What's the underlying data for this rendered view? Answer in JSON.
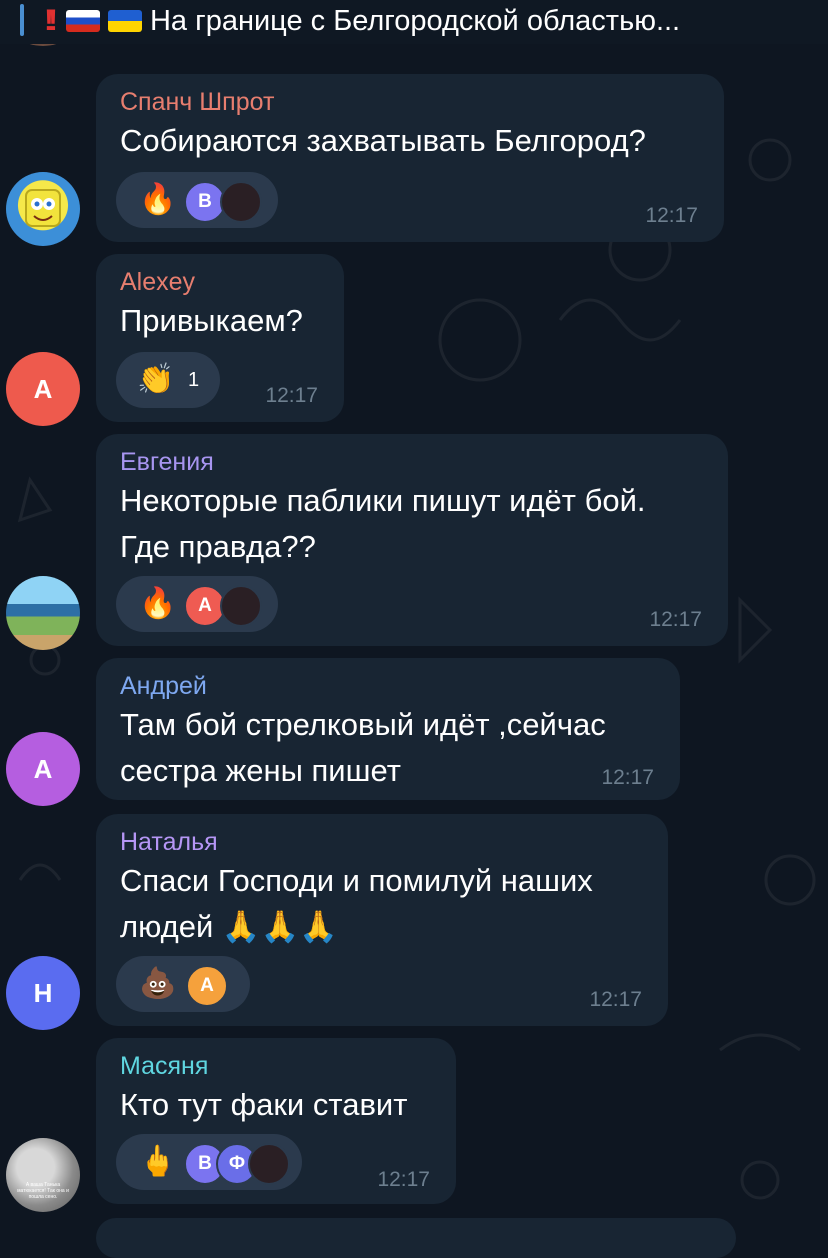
{
  "pinned": {
    "excl": "!!",
    "title": "На границе с Белгородской областью..."
  },
  "colors": {
    "background": "#0e1621",
    "bubble": "#182533",
    "reaction_bg": "#2b3a4d",
    "time": "#6d7f8f",
    "name_spanch": "#e77e6f",
    "name_alexey": "#e77e6f",
    "name_evgenia": "#a795f0",
    "name_andrey": "#7ea8f0",
    "name_natalya": "#b596f5",
    "name_masyanya": "#5fd6e0"
  },
  "messages": [
    {
      "author": "Спанч Шпрот",
      "lines": [
        "Собираются захватывать Белгород?"
      ],
      "time": "12:17",
      "avatar": {
        "type": "image",
        "icon": "spongebob-avatar-icon"
      },
      "reactions": [
        {
          "emoji": "🔥",
          "icon": "fire-icon",
          "avatars": [
            {
              "letter": "B",
              "color": "#7b74f0"
            },
            {
              "letter": "",
              "color": "#2a1f24"
            }
          ]
        }
      ]
    },
    {
      "author": "Alexey",
      "lines": [
        "Привыкаем?"
      ],
      "time": "12:17",
      "avatar": {
        "type": "letter",
        "letter": "A",
        "color": "#ee5a4d"
      },
      "reactions": [
        {
          "emoji": "👏",
          "icon": "clapping-hands-icon",
          "count": "1"
        }
      ]
    },
    {
      "author": "Евгения",
      "lines": [
        "Некоторые паблики пишут идёт бой.",
        "Где правда??"
      ],
      "time": "12:17",
      "avatar": {
        "type": "image",
        "icon": "landscape-avatar-icon"
      },
      "reactions": [
        {
          "emoji": "🔥",
          "icon": "fire-icon",
          "avatars": [
            {
              "letter": "A",
              "color": "#ef5b52"
            },
            {
              "letter": "",
              "color": "#2a1f24"
            }
          ]
        }
      ]
    },
    {
      "author": "Андрей",
      "lines": [
        "Там бой стрелковый идёт ,сейчас",
        "сестра жены пишет"
      ],
      "time": "12:17",
      "avatar": {
        "type": "letter",
        "letter": "A",
        "color": "#b55ee0"
      }
    },
    {
      "author": "Наталья",
      "lines": [
        "Спаси Господи и помилуй наших",
        "людей 🙏🙏🙏"
      ],
      "time": "12:17",
      "avatar": {
        "type": "letter",
        "letter": "H",
        "color": "#5a6cf0"
      },
      "reactions": [
        {
          "emoji": "💩",
          "icon": "poop-icon",
          "avatars": [
            {
              "letter": "A",
              "color": "#f5a13c"
            }
          ]
        }
      ]
    },
    {
      "author": "Масяня",
      "lines": [
        "Кто тут факи ставит"
      ],
      "time": "12:17",
      "avatar": {
        "type": "image",
        "icon": "photo-avatar-icon",
        "caption": "А ваша Танька матюкается! Так она и пошла сено."
      },
      "reactions": [
        {
          "emoji": "🖕",
          "icon": "middle-finger-icon",
          "avatars": [
            {
              "letter": "B",
              "color": "#7b74f0"
            },
            {
              "letter": "Ф",
              "color": "#6a6ee8"
            },
            {
              "letter": "",
              "color": "#2a1f24"
            }
          ]
        }
      ]
    }
  ]
}
